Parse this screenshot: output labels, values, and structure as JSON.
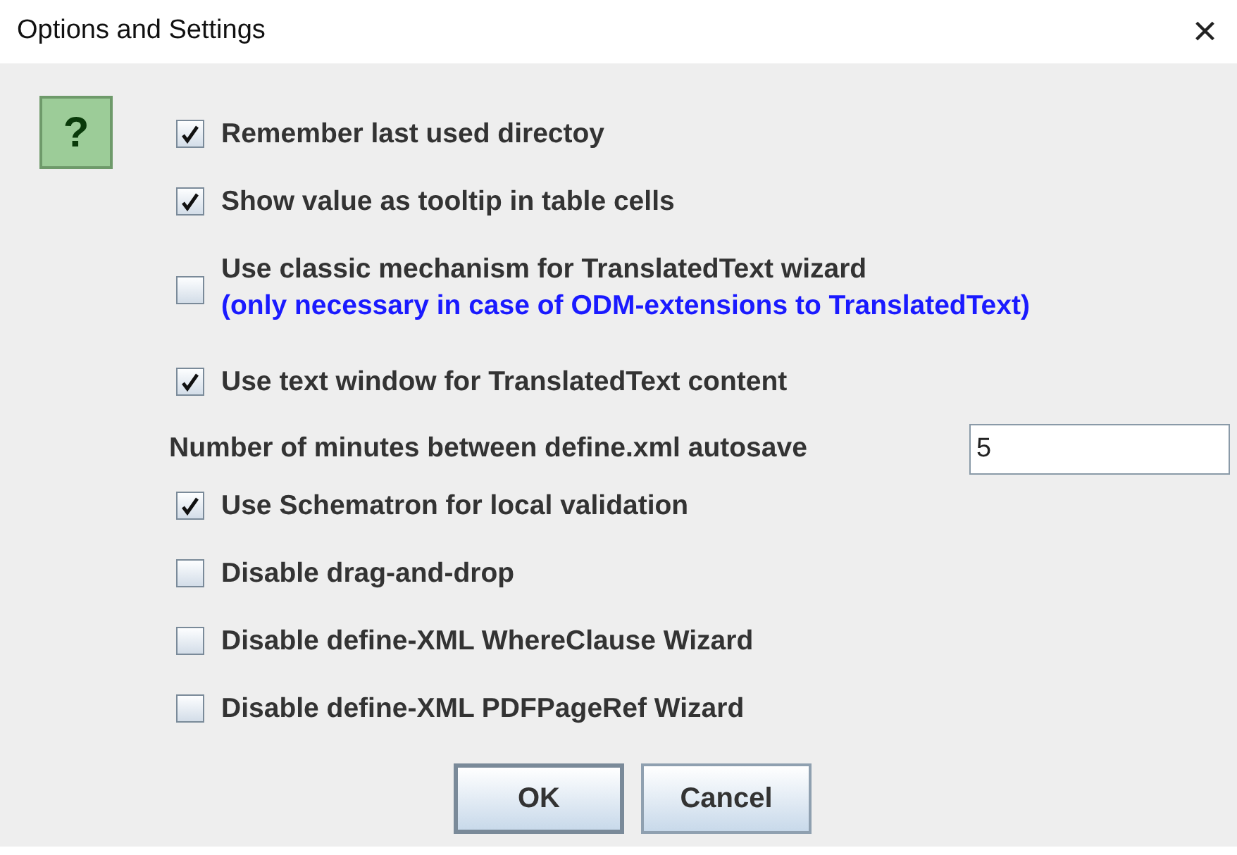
{
  "window": {
    "title": "Options and Settings",
    "close": "×"
  },
  "help_icon": {
    "text": "?"
  },
  "options": [
    {
      "kind": "checkbox",
      "label": "Remember last used directoy",
      "checked": true
    },
    {
      "kind": "checkbox",
      "label": "Show value as tooltip in table cells",
      "checked": true
    },
    {
      "kind": "checkbox",
      "label": "Use classic mechanism for TranslatedText wizard",
      "note": "(only necessary in case of ODM-extensions to TranslatedText)",
      "checked": false
    },
    {
      "kind": "checkbox",
      "label": "Use text window for TranslatedText content",
      "checked": true
    },
    {
      "kind": "field",
      "label": "Number of minutes between define.xml autosave",
      "value": "5"
    },
    {
      "kind": "checkbox",
      "label": "Use Schematron for local validation",
      "checked": true
    },
    {
      "kind": "checkbox",
      "label": "Disable drag-and-drop",
      "checked": false
    },
    {
      "kind": "checkbox",
      "label": "Disable define-XML WhereClause Wizard",
      "checked": false
    },
    {
      "kind": "checkbox",
      "label": "Disable define-XML PDFPageRef Wizard",
      "checked": false
    }
  ],
  "buttons": [
    {
      "label": "OK",
      "default": true
    },
    {
      "label": "Cancel",
      "default": false
    }
  ]
}
